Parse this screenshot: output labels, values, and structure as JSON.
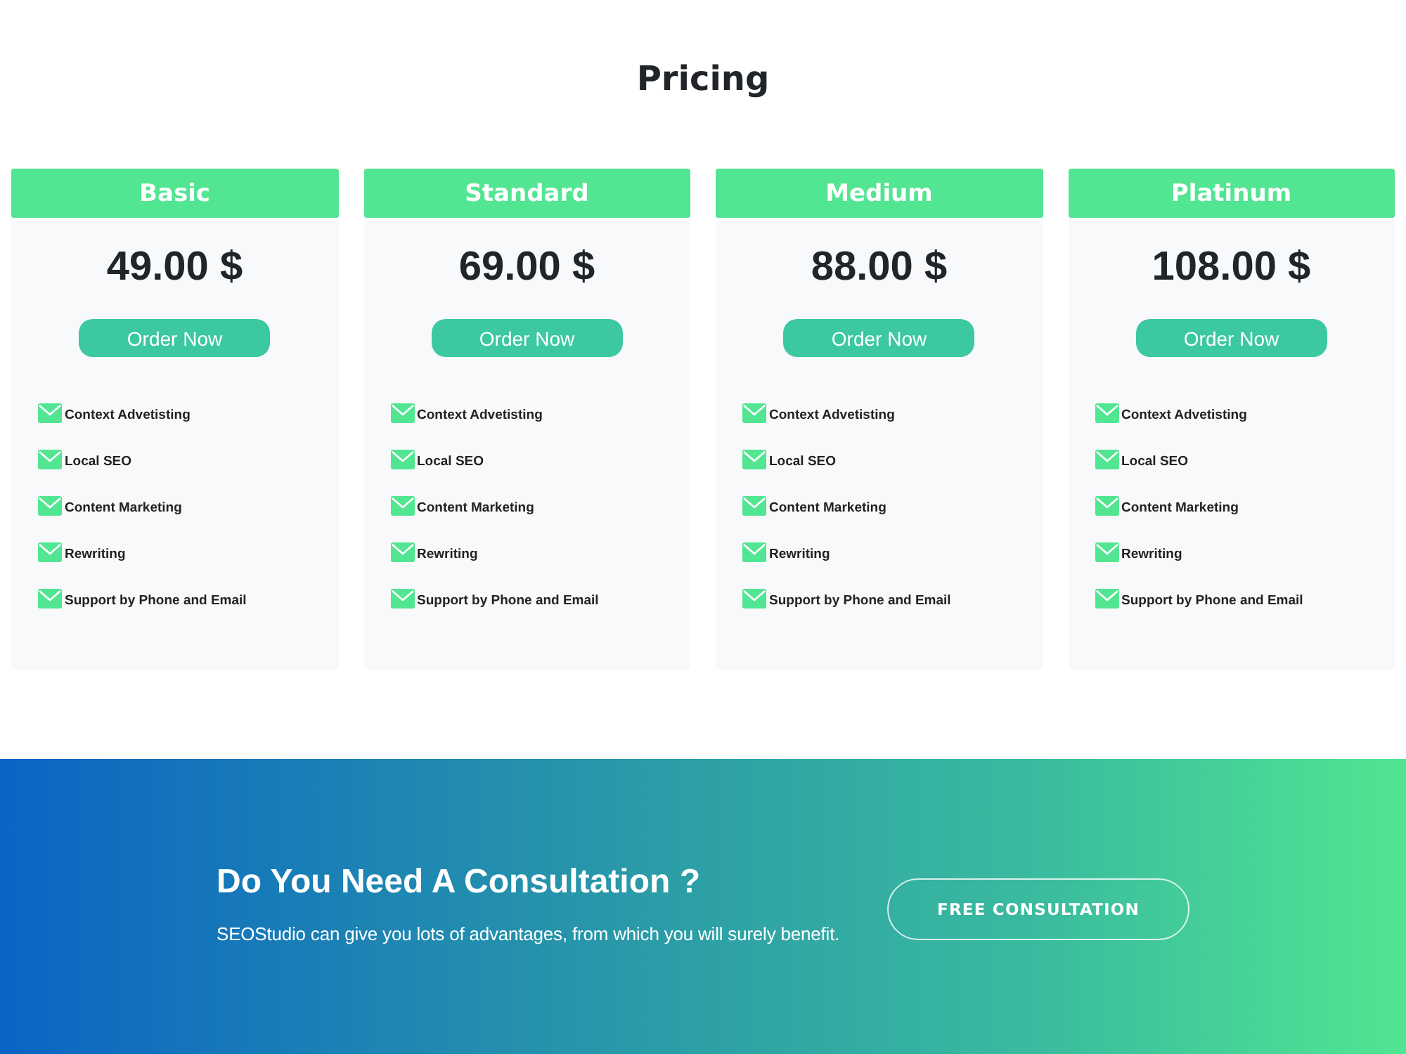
{
  "section_title": "Pricing",
  "plans": [
    {
      "name": "Basic",
      "price": "49.00 $",
      "button": "Order Now",
      "features": [
        "Context Advetisting",
        "Local SEO",
        "Content Marketing",
        "Rewriting",
        "Support by Phone and Email"
      ]
    },
    {
      "name": "Standard",
      "price": "69.00 $",
      "button": "Order Now",
      "features": [
        "Context Advetisting",
        "Local SEO",
        "Content Marketing",
        "Rewriting",
        "Support by Phone and Email"
      ]
    },
    {
      "name": "Medium",
      "price": "88.00 $",
      "button": "Order Now",
      "features": [
        "Context Advetisting",
        "Local SEO",
        "Content Marketing",
        "Rewriting",
        "Support by Phone and Email"
      ]
    },
    {
      "name": "Platinum",
      "price": "108.00 $",
      "button": "Order Now",
      "features": [
        "Context Advetisting",
        "Local SEO",
        "Content Marketing",
        "Rewriting",
        "Support by Phone and Email"
      ]
    }
  ],
  "consultation": {
    "heading": "Do You Need A Consultation ?",
    "text": "SEOStudio can give you lots of advantages, from which you will surely benefit.",
    "button": "FREE CONSULTATION"
  }
}
